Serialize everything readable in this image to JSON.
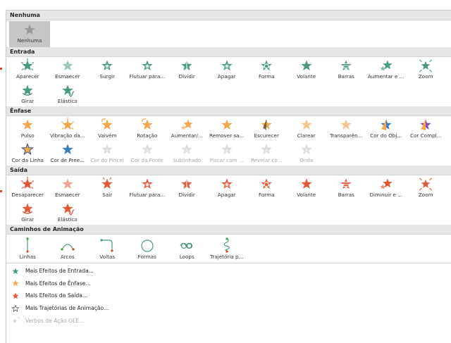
{
  "colors": {
    "entrance": "#4a9a7e",
    "entrance_light": "#8fc9b3",
    "emphasis": "#f0a850",
    "emphasis_dark": "#e08a2e",
    "exit": "#e05a3a",
    "path": "#4a9a7e",
    "none": "#9a9a9a"
  },
  "sections": [
    {
      "id": "nenhuma",
      "title": "Nenhuma",
      "kind": "none",
      "items": [
        {
          "label": "Nenhuma",
          "icon": "star-none-icon",
          "selected": true
        }
      ]
    },
    {
      "id": "entrada",
      "title": "Entrada",
      "kind": "entrance",
      "items": [
        {
          "label": "Aparecer",
          "icon": "star-burst-icon"
        },
        {
          "label": "Esmaecer",
          "icon": "star-fade-icon"
        },
        {
          "label": "Surgir",
          "icon": "star-wipe-icon"
        },
        {
          "label": "Flutuar para...",
          "icon": "star-float-icon"
        },
        {
          "label": "Dividir",
          "icon": "star-split-icon"
        },
        {
          "label": "Apagar",
          "icon": "star-wipe-icon"
        },
        {
          "label": "Forma",
          "icon": "star-shape-icon"
        },
        {
          "label": "Volante",
          "icon": "star-wheel-icon"
        },
        {
          "label": "Barras",
          "icon": "star-bars-icon"
        },
        {
          "label": "Aumentar e ...",
          "icon": "star-grow-icon"
        },
        {
          "label": "Zoom",
          "icon": "star-zoom-icon"
        },
        {
          "label": "Girar",
          "icon": "star-swivel-icon"
        },
        {
          "label": "Elástico",
          "icon": "star-bounce-icon"
        }
      ]
    },
    {
      "id": "enfase",
      "title": "Ênfase",
      "kind": "emphasis",
      "items": [
        {
          "label": "Pulso",
          "icon": "star-pulse-icon"
        },
        {
          "label": "Vibração da...",
          "icon": "star-burst-icon"
        },
        {
          "label": "Vaivém",
          "icon": "star-teeter-icon"
        },
        {
          "label": "Rotação",
          "icon": "star-spin-icon"
        },
        {
          "label": "Aumentar/...",
          "icon": "star-grow-icon"
        },
        {
          "label": "Remover sa...",
          "icon": "star-desaturate-icon"
        },
        {
          "label": "Escurecer",
          "icon": "star-darken-icon"
        },
        {
          "label": "Clarear",
          "icon": "star-lighten-icon"
        },
        {
          "label": "Transparên...",
          "icon": "star-transparency-icon"
        },
        {
          "label": "Cor do Obj...",
          "icon": "star-object-color-icon"
        },
        {
          "label": "Cor Compl...",
          "icon": "star-complement-icon"
        },
        {
          "label": "Cor da Linha",
          "icon": "star-line-color-icon"
        },
        {
          "label": "Cor de Pree...",
          "icon": "star-fill-color-icon"
        },
        {
          "label": "Cor do Pincel",
          "icon": "star-brush-icon",
          "disabled": true
        },
        {
          "label": "Cor da Fonte",
          "icon": "star-font-color-icon",
          "disabled": true
        },
        {
          "label": "Sublinhado",
          "icon": "star-underline-icon",
          "disabled": true
        },
        {
          "label": "Piscar com ...",
          "icon": "star-bold-flash-icon",
          "disabled": true
        },
        {
          "label": "Revelar co...",
          "icon": "star-bold-reveal-icon",
          "disabled": true
        },
        {
          "label": "Onda",
          "icon": "star-wave-icon",
          "disabled": true
        }
      ]
    },
    {
      "id": "saida",
      "title": "Saída",
      "kind": "exit",
      "items": [
        {
          "label": "Desaparecer",
          "icon": "star-burst-icon"
        },
        {
          "label": "Esmaecer",
          "icon": "star-fade-icon"
        },
        {
          "label": "Sair",
          "icon": "star-fly-out-icon"
        },
        {
          "label": "Flutuar para...",
          "icon": "star-float-icon"
        },
        {
          "label": "Dividir",
          "icon": "star-split-icon"
        },
        {
          "label": "Apagar",
          "icon": "star-wipe-icon"
        },
        {
          "label": "Forma",
          "icon": "star-shape-icon"
        },
        {
          "label": "Volante",
          "icon": "star-wheel-icon"
        },
        {
          "label": "Barras",
          "icon": "star-bars-icon"
        },
        {
          "label": "Diminuir e ...",
          "icon": "star-shrink-icon"
        },
        {
          "label": "Zoom",
          "icon": "star-zoom-icon"
        },
        {
          "label": "Girar",
          "icon": "star-swivel-icon"
        },
        {
          "label": "Elástico",
          "icon": "star-bounce-icon"
        }
      ]
    },
    {
      "id": "caminhos",
      "title": "Caminhos de Animação",
      "kind": "path",
      "items": [
        {
          "label": "Linhas",
          "icon": "path-line-icon"
        },
        {
          "label": "Arcos",
          "icon": "path-arc-icon"
        },
        {
          "label": "Voltas",
          "icon": "path-turn-icon"
        },
        {
          "label": "Formas",
          "icon": "path-shape-icon"
        },
        {
          "label": "Loops",
          "icon": "path-loop-icon"
        },
        {
          "label": "Trajetória p...",
          "icon": "path-custom-icon"
        }
      ]
    }
  ],
  "more": [
    {
      "label": "Mais Efeitos de Entrada...",
      "icon": "entrance-star-icon",
      "kind": "entrance"
    },
    {
      "label": "Mais Efeitos de Ênfase...",
      "icon": "emphasis-star-icon",
      "kind": "emphasis"
    },
    {
      "label": "Mais Efeitos de Saída...",
      "icon": "exit-star-icon",
      "kind": "exit"
    },
    {
      "label": "Mais Trajetórias de Animação...",
      "icon": "motion-path-star-icon",
      "kind": "outline"
    },
    {
      "label": "Verbos de Ação OLE...",
      "icon": "ole-action-icon",
      "kind": "ole",
      "disabled": true
    }
  ]
}
